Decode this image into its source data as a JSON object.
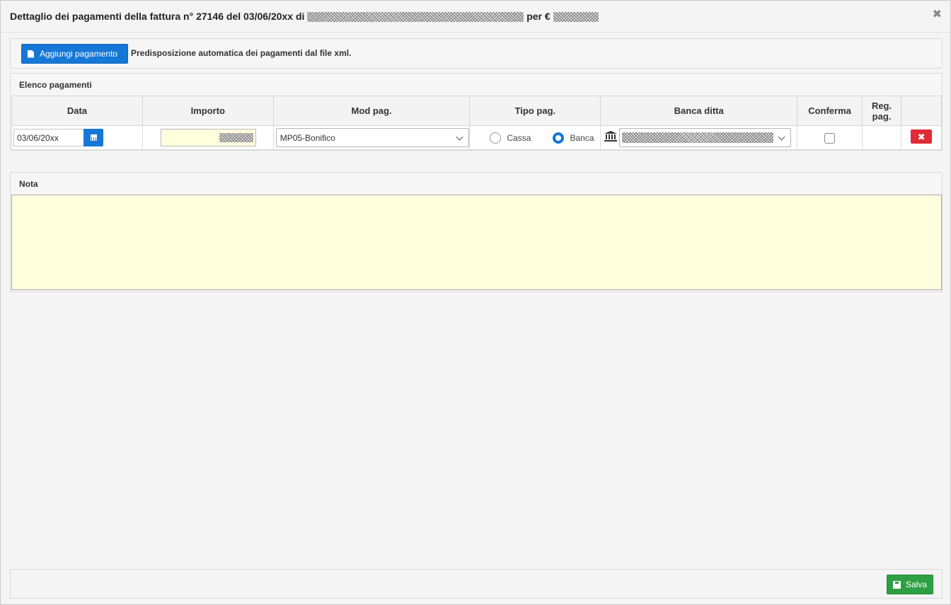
{
  "dialog": {
    "title_prefix": "Dettaglio dei pagamenti della fattura n° 27146 del 03/06/20xx di",
    "title_per": "per €",
    "close_glyph": "✖"
  },
  "toolbar": {
    "add_payment_label": "Aggiungi pagamento",
    "auto_text": "Predisposizione automatica dei pagamenti dal file xml."
  },
  "payments": {
    "panel_title": "Elenco pagamenti",
    "columns": [
      "Data",
      "Importo",
      "Mod pag.",
      "Tipo pag.",
      "Banca ditta",
      "Conferma",
      "Reg. pag.",
      ""
    ],
    "rows": [
      {
        "date": "03/06/20xx",
        "mod_pag": "MP05-Bonifico",
        "tipo_options": [
          "Cassa",
          "Banca"
        ],
        "tipo_selected": "Banca",
        "conferma": false
      }
    ]
  },
  "nota": {
    "panel_title": "Nota",
    "value": ""
  },
  "footer": {
    "save_label": "Salva"
  },
  "colors": {
    "primary": "#1577d6",
    "danger": "#e02b35",
    "success": "#2ea043",
    "input_highlight": "#ffffdd"
  }
}
